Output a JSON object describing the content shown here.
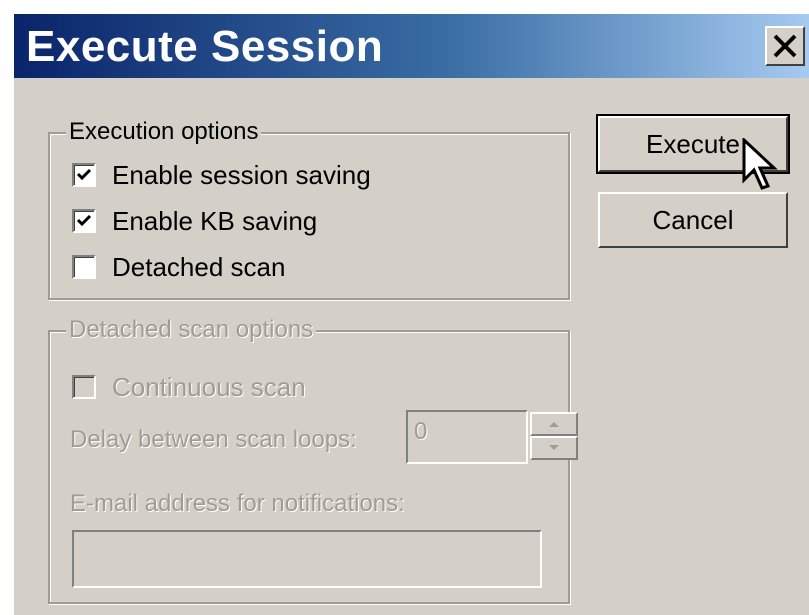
{
  "window": {
    "title": "Execute Session",
    "close_icon": "close-icon"
  },
  "execution_options": {
    "legend": "Execution options",
    "items": [
      {
        "label": "Enable session saving",
        "checked": true
      },
      {
        "label": "Enable KB saving",
        "checked": true
      },
      {
        "label": "Detached scan",
        "checked": false
      }
    ]
  },
  "detached_options": {
    "legend": "Detached scan options",
    "enabled": false,
    "continuous_scan": {
      "label": "Continuous scan",
      "checked": false
    },
    "delay_label": "Delay between scan loops:",
    "delay_value": "0",
    "email_label": "E-mail address for notifications:",
    "email_value": ""
  },
  "buttons": {
    "execute": "Execute",
    "cancel": "Cancel"
  },
  "colors": {
    "title_start": "#0a246a",
    "title_end": "#a6caf0",
    "face": "#d4d0c8",
    "disabled_text": "#a09c94"
  }
}
